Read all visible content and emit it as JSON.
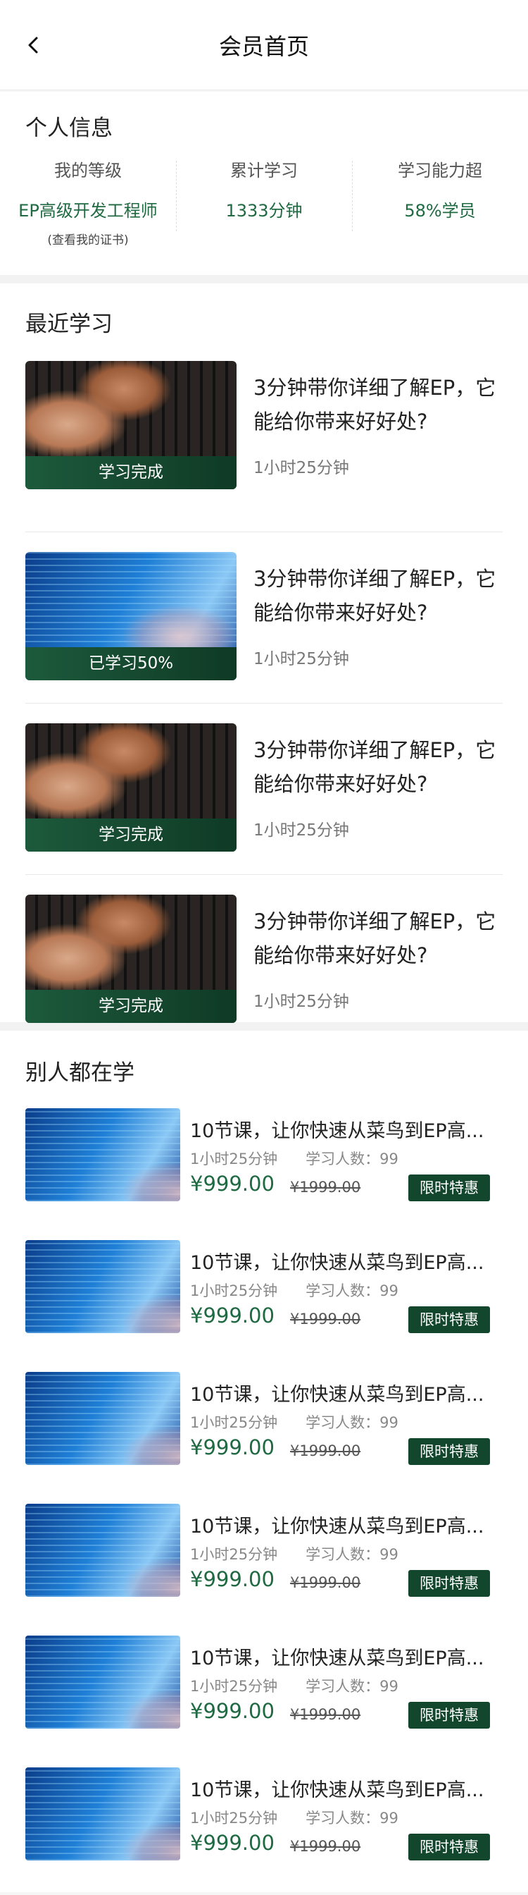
{
  "header": {
    "title": "会员首页",
    "back_icon": "chevron-left-icon"
  },
  "profile": {
    "title": "个人信息",
    "stats": [
      {
        "label": "我的等级",
        "value": "EP高级开发工程师",
        "sub": "(查看我的证书)"
      },
      {
        "label": "累计学习",
        "value": "1333分钟"
      },
      {
        "label": "学习能力超",
        "value": "58%学员"
      }
    ]
  },
  "recent": {
    "title": "最近学习",
    "items": [
      {
        "image": "keyboard-photo",
        "status": "学习完成",
        "title": "3分钟带你详细了解EP，它能给你带来好好处?",
        "duration": "1小时25分钟"
      },
      {
        "image": "code-screen-photo",
        "status": "已学习50%",
        "title": "3分钟带你详细了解EP，它能给你带来好好处?",
        "duration": "1小时25分钟"
      },
      {
        "image": "keyboard-photo",
        "status": "学习完成",
        "title": "3分钟带你详细了解EP，它能给你带来好好处?",
        "duration": "1小时25分钟"
      },
      {
        "image": "keyboard-photo",
        "status": "学习完成",
        "title": "3分钟带你详细了解EP，它能给你带来好好处?",
        "duration": "1小时25分钟"
      }
    ]
  },
  "popular": {
    "title": "别人都在学",
    "courses": [
      {
        "title": "10节课，让你快速从菜鸟到EP高...",
        "duration": "1小时25分钟",
        "learners": "学习人数：99",
        "price": "¥999.00",
        "old_price": "¥1999.00",
        "badge": "限时特惠"
      },
      {
        "title": "10节课，让你快速从菜鸟到EP高...",
        "duration": "1小时25分钟",
        "learners": "学习人数：99",
        "price": "¥999.00",
        "old_price": "¥1999.00",
        "badge": "限时特惠"
      },
      {
        "title": "10节课，让你快速从菜鸟到EP高...",
        "duration": "1小时25分钟",
        "learners": "学习人数：99",
        "price": "¥999.00",
        "old_price": "¥1999.00",
        "badge": "限时特惠"
      },
      {
        "title": "10节课，让你快速从菜鸟到EP高...",
        "duration": "1小时25分钟",
        "learners": "学习人数：99",
        "price": "¥999.00",
        "old_price": "¥1999.00",
        "badge": "限时特惠"
      },
      {
        "title": "10节课，让你快速从菜鸟到EP高...",
        "duration": "1小时25分钟",
        "learners": "学习人数：99",
        "price": "¥999.00",
        "old_price": "¥1999.00",
        "badge": "限时特惠"
      },
      {
        "title": "10节课，让你快速从菜鸟到EP高...",
        "duration": "1小时25分钟",
        "learners": "学习人数：99",
        "price": "¥999.00",
        "old_price": "¥1999.00",
        "badge": "限时特惠"
      }
    ]
  },
  "colors": {
    "accent": "#1f6a42",
    "badge": "#13472d",
    "status_bar": "#1d5a3c"
  }
}
